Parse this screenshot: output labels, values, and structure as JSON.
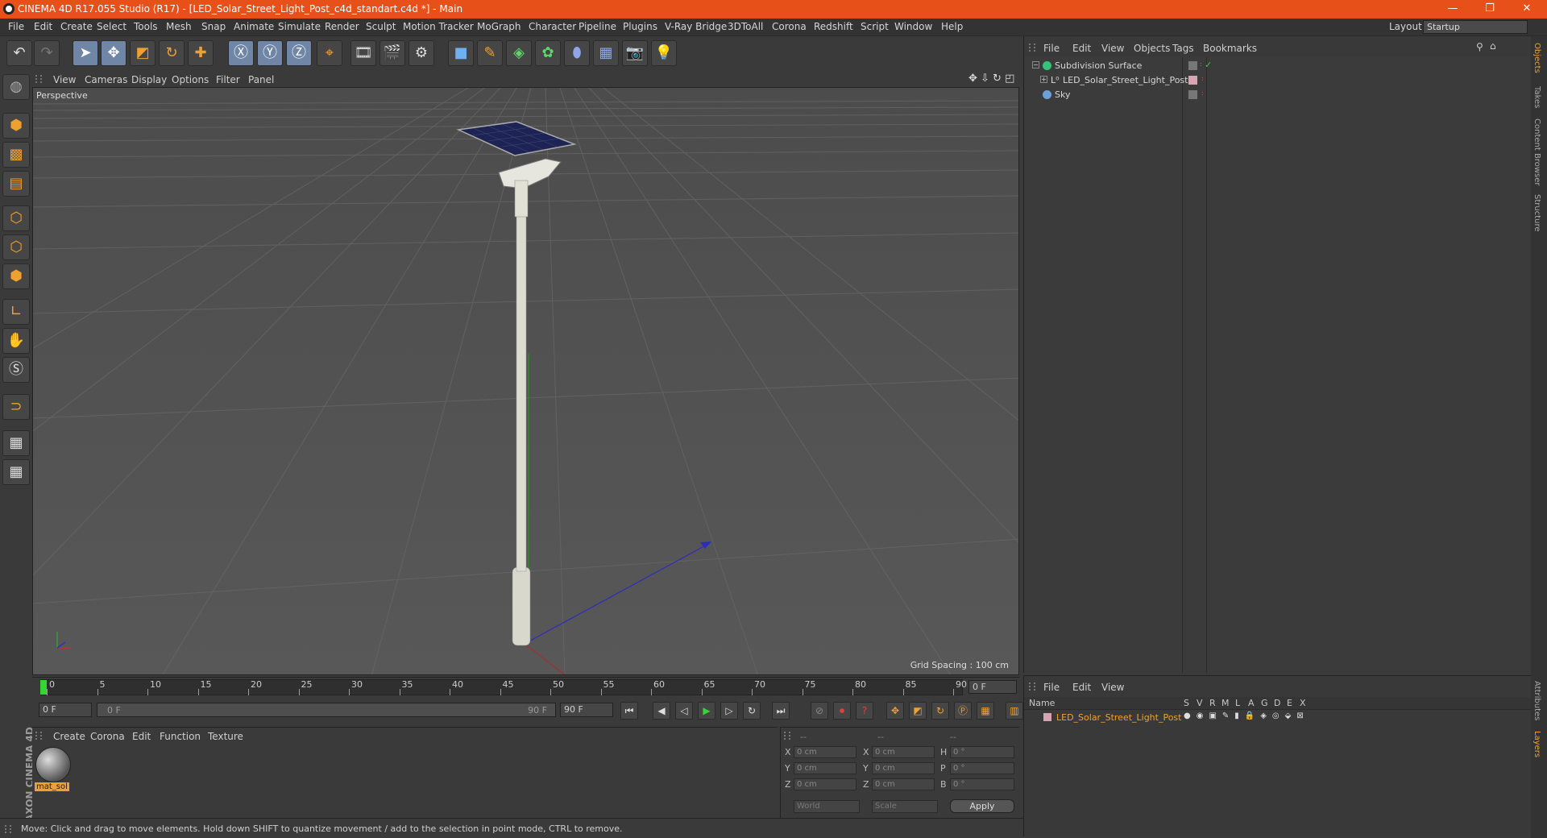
{
  "window": {
    "title": "CINEMA 4D R17.055 Studio (R17) - [LED_Solar_Street_Light_Post_c4d_standart.c4d *] - Main",
    "controls": [
      "—",
      "❐",
      "✕"
    ]
  },
  "menubar": {
    "items": [
      "File",
      "Edit",
      "Create",
      "Select",
      "Tools",
      "Mesh",
      "Snap",
      "Animate",
      "Simulate",
      "Render",
      "Sculpt",
      "Motion Tracker",
      "MoGraph",
      "Character",
      "Pipeline",
      "Plugins",
      "V-Ray Bridge",
      "3DToAll",
      "Corona",
      "Redshift",
      "Script",
      "Window",
      "Help"
    ],
    "layout_label": "Layout:",
    "layout_value": "Startup"
  },
  "viewport": {
    "menu": [
      "View",
      "Cameras",
      "Display",
      "Options",
      "Filter",
      "Panel"
    ],
    "label": "Perspective",
    "grid_spacing": "Grid Spacing : 100 cm"
  },
  "timeline": {
    "ticks": [
      "0",
      "5",
      "10",
      "15",
      "20",
      "25",
      "30",
      "35",
      "40",
      "45",
      "50",
      "55",
      "60",
      "65",
      "70",
      "75",
      "80",
      "85",
      "90"
    ],
    "current_frame": "0 F",
    "start_field": "0 F",
    "range_left": "0 F",
    "range_right": "90 F",
    "end_field": "90 F"
  },
  "material_manager": {
    "menu": [
      "Create",
      "Corona",
      "Edit",
      "Function",
      "Texture"
    ],
    "materials": [
      {
        "name": "mat_sol"
      }
    ]
  },
  "coordinates": {
    "header": [
      "--",
      "--",
      "--"
    ],
    "rows": [
      {
        "a": "X",
        "av": "0 cm",
        "b": "X",
        "bv": "0 cm",
        "c": "H",
        "cv": "0 °"
      },
      {
        "a": "Y",
        "av": "0 cm",
        "b": "Y",
        "bv": "0 cm",
        "c": "P",
        "cv": "0 °"
      },
      {
        "a": "Z",
        "av": "0 cm",
        "b": "Z",
        "bv": "0 cm",
        "c": "B",
        "cv": "0 °"
      }
    ],
    "mode1": "World",
    "mode2": "Scale",
    "apply": "Apply"
  },
  "object_manager": {
    "menu": [
      "File",
      "Edit",
      "View",
      "Objects",
      "Tags",
      "Bookmarks"
    ],
    "objects": [
      {
        "name": "Subdivision Surface",
        "indent": 0
      },
      {
        "name": "LED_Solar_Street_Light_Post",
        "indent": 1
      },
      {
        "name": "Sky",
        "indent": 0
      }
    ]
  },
  "layer_manager": {
    "menu": [
      "File",
      "Edit",
      "View"
    ],
    "columns": [
      "Name",
      "S",
      "V",
      "R",
      "M",
      "L",
      "A",
      "G",
      "D",
      "E",
      "X"
    ],
    "layers": [
      {
        "name": "LED_Solar_Street_Light_Post"
      }
    ]
  },
  "right_tabs": [
    "Objects",
    "Takes",
    "Content Browser",
    "Structure",
    "Attributes",
    "Layers"
  ],
  "status": "Move: Click and drag to move elements. Hold down SHIFT to quantize movement / add to the selection in point mode, CTRL to remove.",
  "brand": "MAXON CINEMA 4D",
  "colors": {
    "title_bar": "#e8501a",
    "accent": "#f0a030",
    "selected_text": "#f0a030"
  }
}
